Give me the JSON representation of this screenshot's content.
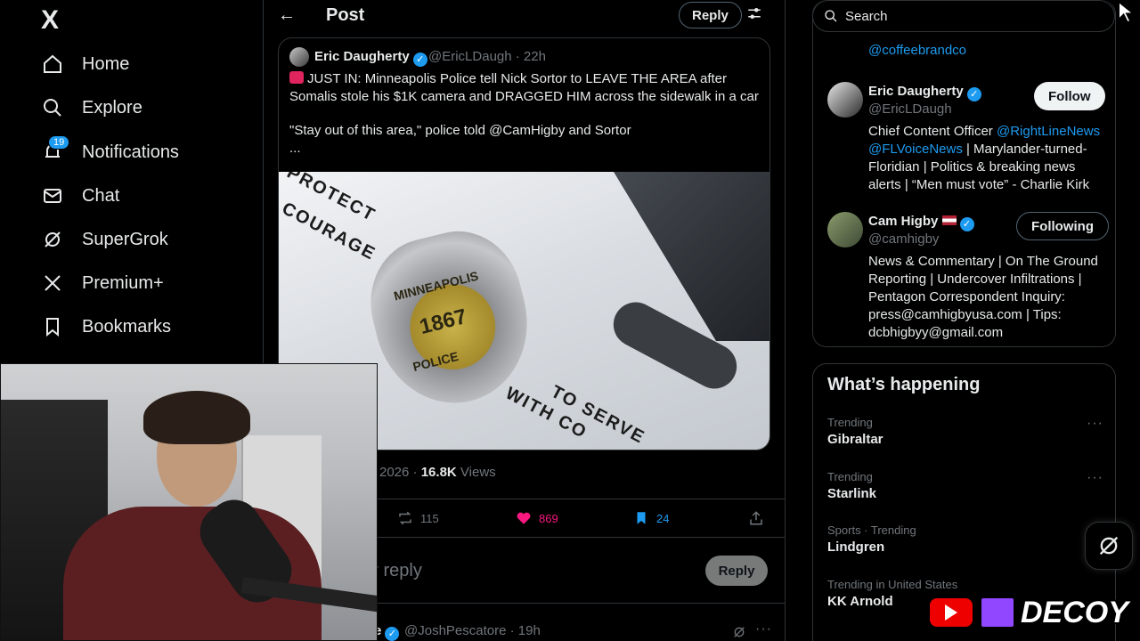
{
  "nav": {
    "logo": "X",
    "items": [
      {
        "label": "Home",
        "icon": "home-icon"
      },
      {
        "label": "Explore",
        "icon": "search-icon"
      },
      {
        "label": "Notifications",
        "icon": "bell-icon",
        "badge": "19"
      },
      {
        "label": "Chat",
        "icon": "mail-icon"
      },
      {
        "label": "SuperGrok",
        "icon": "grok-icon"
      },
      {
        "label": "Premium+",
        "icon": "x-logo-icon"
      },
      {
        "label": "Bookmarks",
        "icon": "bookmark-icon"
      }
    ]
  },
  "header": {
    "title": "Post",
    "reply_label": "Reply"
  },
  "quote": {
    "name": "Eric Daugherty",
    "handle": "@EricLDaugh · 22h",
    "line1": "JUST IN: Minneapolis Police tell Nick Sortor to LEAVE THE AREA after Somalis stole his $1K camera and DRAGGED HIM across the sidewalk in a car",
    "line2": "\"Stay out of this area,\" police told @CamHigby and Sortor",
    "line3": "...",
    "media": {
      "text_protect": "PROTECT",
      "text_courage": "COURAGE",
      "badge_top": "MINNEAPOLIS",
      "badge_num": "1867",
      "badge_bottom": "POLICE",
      "text_serve": "TO SERVE",
      "text_with": "WITH CO"
    }
  },
  "stats": {
    "date": "2026",
    "views_count": "16.8K",
    "views_label": "Views"
  },
  "actions": {
    "retweets": "115",
    "likes": "869",
    "bookmarks": "24"
  },
  "reply_box": {
    "placeholder": "our reply",
    "button": "Reply"
  },
  "next_post": {
    "name": "e",
    "handle": "@JoshPescatore · 19h"
  },
  "search": {
    "placeholder": "Search"
  },
  "who_to_follow": {
    "partial_link": "@coffeebrandco",
    "people": [
      {
        "name": "Eric Daugherty",
        "handle": "@EricLDaugh",
        "bio_link1": "@RightLineNews",
        "bio_prefix": "Chief Content Officer ",
        "bio_link2": "@FLVoiceNews",
        "bio_rest": " | Marylander-turned-Floridian | Politics & breaking news alerts | “Men must vote” - Charlie Kirk",
        "button": "Follow"
      },
      {
        "name": "Cam Higby",
        "handle": "@camhigby",
        "bio": "News & Commentary | On The Ground Reporting | Undercover Infiltrations | Pentagon Correspondent Inquiry: press@camhigbyusa.com | Tips: dcbhigbyy@gmail.com",
        "button": "Following"
      }
    ]
  },
  "trends": {
    "title": "What’s happening",
    "items": [
      {
        "meta": "Trending",
        "name": "Gibraltar"
      },
      {
        "meta": "Trending",
        "name": "Starlink"
      },
      {
        "meta": "Sports · Trending",
        "name": "Lindgren"
      },
      {
        "meta": "Trending in United States",
        "name": "KK Arnold"
      }
    ]
  },
  "branding": {
    "text": "DECOY"
  },
  "colors": {
    "accent": "#1d9bf0",
    "like": "#f91880",
    "background": "#000000"
  }
}
